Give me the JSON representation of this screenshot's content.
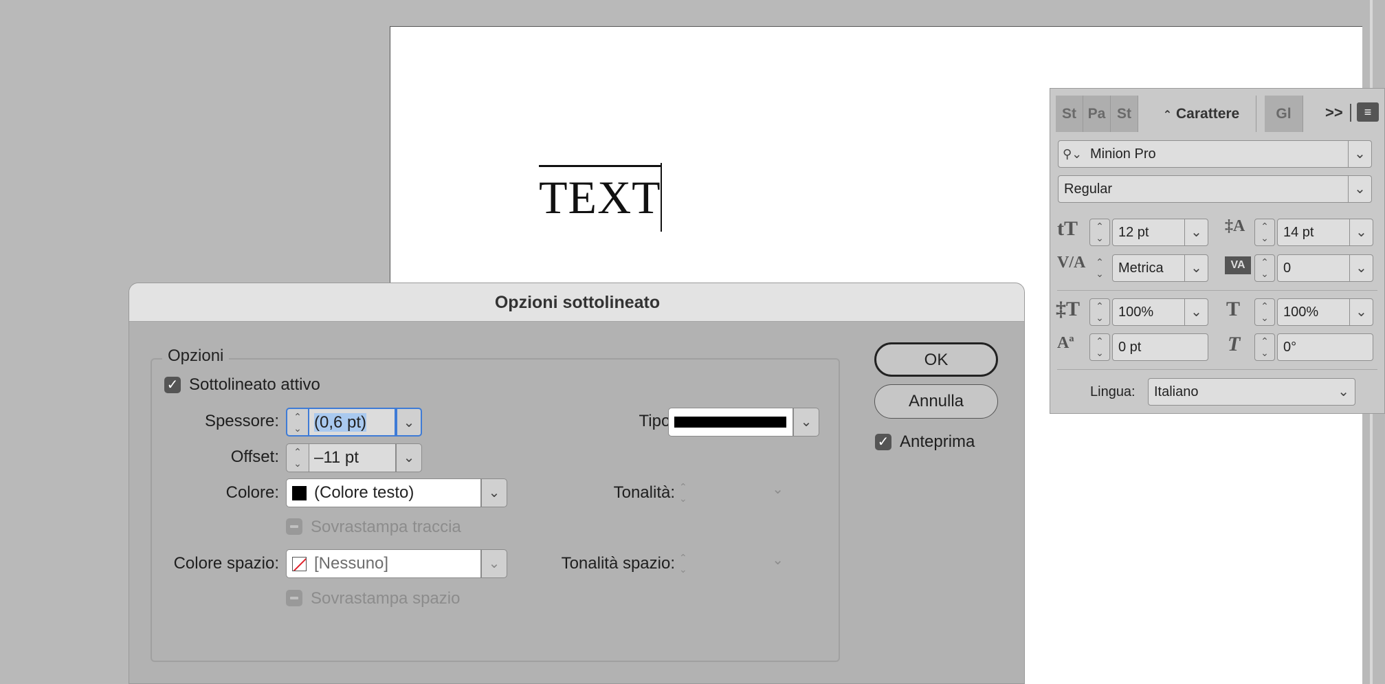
{
  "document": {
    "sample_text": "TEXT"
  },
  "char_panel": {
    "tabs": [
      "St",
      "Pa",
      "St",
      "Carattere",
      "Gl"
    ],
    "active_tab_prefix": "⌃",
    "overflow_label": ">>",
    "font_family": "Minion Pro",
    "font_style": "Regular",
    "font_size": "12 pt",
    "leading": "14 pt",
    "kerning": "Metrica",
    "tracking": "0",
    "vertical_scale": "100%",
    "horizontal_scale": "100%",
    "baseline_shift": "0 pt",
    "skew": "0°",
    "language_label": "Lingua:",
    "language_value": "Italiano"
  },
  "dialog": {
    "title": "Opzioni sottolineato",
    "group_label": "Opzioni",
    "underline_on_label": "Sottolineato attivo",
    "underline_on": true,
    "weight_label": "Spessore:",
    "weight_value": "(0,6 pt)",
    "type_label": "Tipo:",
    "offset_label": "Offset:",
    "offset_value": "–11 pt",
    "color_label": "Colore:",
    "color_value": "(Colore testo)",
    "tint_label": "Tonalità:",
    "overprint_stroke_label": "Sovrastampa traccia",
    "gap_color_label": "Colore spazio:",
    "gap_color_value": "[Nessuno]",
    "gap_tint_label": "Tonalità spazio:",
    "overprint_gap_label": "Sovrastampa spazio",
    "ok_label": "OK",
    "cancel_label": "Annulla",
    "preview_label": "Anteprima",
    "preview_on": true
  }
}
